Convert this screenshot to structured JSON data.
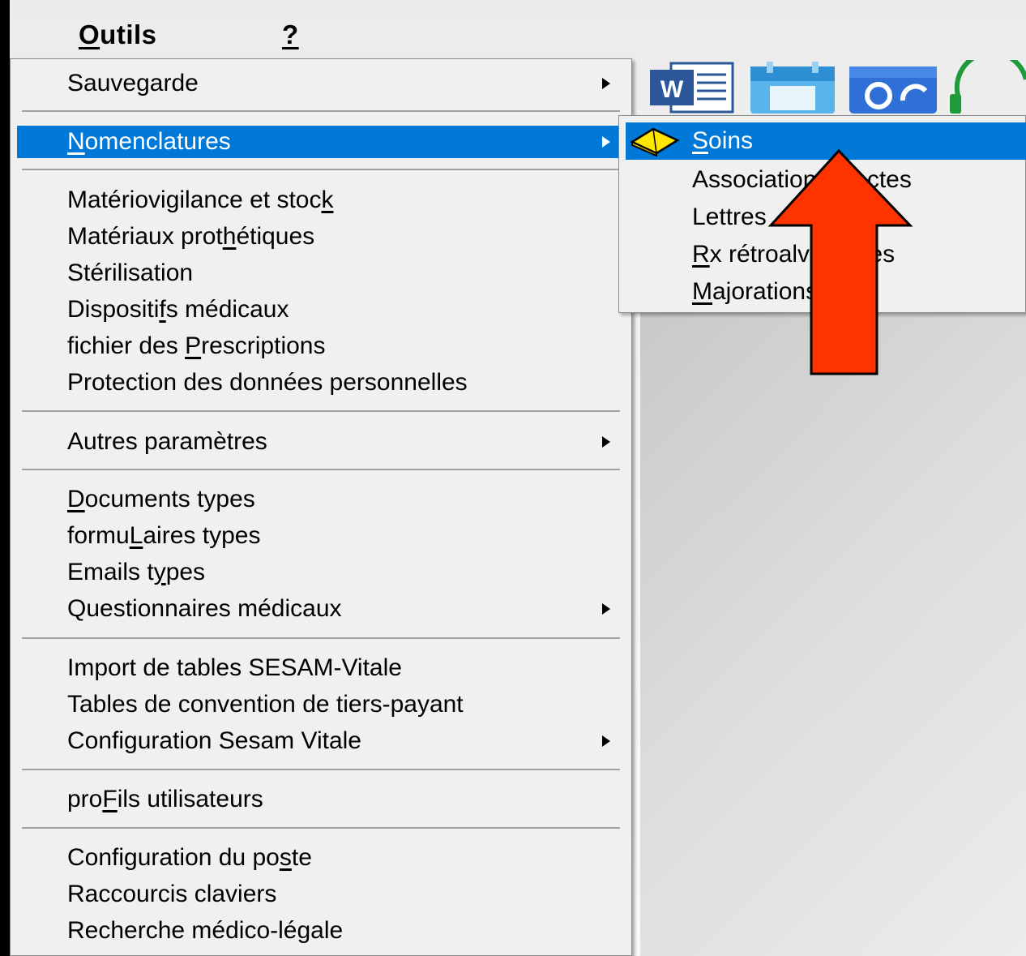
{
  "menubar": {
    "items": [
      {
        "label": "Outils",
        "key": "O",
        "rest": "utils"
      },
      {
        "label": "?"
      }
    ]
  },
  "toolbar": {
    "icons": [
      "word-icon",
      "calendar-icon",
      "google-sync-icon",
      "headset-icon"
    ],
    "word_letter": "W"
  },
  "menu": {
    "items": [
      {
        "pre": "Sauve",
        "key": "g",
        "post": "arde",
        "submenu": true
      },
      {
        "pre": "",
        "key": "N",
        "post": "omenclatures",
        "submenu": true,
        "highlighted": true
      },
      {
        "pre": "Matériovigilance et stoc",
        "key": "k",
        "post": ""
      },
      {
        "pre": "Matériaux prot",
        "key": "h",
        "post": "étiques"
      },
      {
        "pre": "Stérilisation",
        "key": "",
        "post": ""
      },
      {
        "pre": "Dispositi",
        "key": "f",
        "post": "s médicaux"
      },
      {
        "pre": "fichier des ",
        "key": "P",
        "post": "rescriptions"
      },
      {
        "pre": "Protection des données personnelles",
        "key": "",
        "post": ""
      },
      {
        "pre": "Autres paramètres",
        "key": "",
        "post": "",
        "submenu": true
      },
      {
        "pre": "",
        "key": "D",
        "post": "ocuments types"
      },
      {
        "pre": "formu",
        "key": "L",
        "post": "aires types"
      },
      {
        "pre": "Emails t",
        "key": "y",
        "post": "pes"
      },
      {
        "pre": "Questionnaires médicaux",
        "key": "",
        "post": "",
        "submenu": true
      },
      {
        "pre": "Import de tables SESAM-Vitale",
        "key": "",
        "post": ""
      },
      {
        "pre": "Tables de convention de tiers-payant",
        "key": "",
        "post": ""
      },
      {
        "pre": "Configuration Sesam Vitale",
        "key": "",
        "post": "",
        "submenu": true
      },
      {
        "pre": "pro",
        "key": "F",
        "post": "ils utilisateurs"
      },
      {
        "pre": "Configuration du po",
        "key": "s",
        "post": "te"
      },
      {
        "pre": "Raccourcis claviers",
        "key": "",
        "post": ""
      },
      {
        "pre": "Recherche médico-légale",
        "key": "",
        "post": ""
      }
    ]
  },
  "submenu": {
    "items": [
      {
        "pre": "",
        "key": "S",
        "post": "oins",
        "highlighted": true,
        "icon": "book-icon"
      },
      {
        "pre": "Associations d'actes",
        "key": "",
        "post": ""
      },
      {
        "pre": "Lettres",
        "key": "",
        "post": ""
      },
      {
        "pre": "",
        "key": "R",
        "post": "x rétroalvéolaires"
      },
      {
        "pre": "",
        "key": "M",
        "post": "ajorations"
      }
    ]
  },
  "annotation": {
    "icon": "red-arrow-icon",
    "color": "#ff3300"
  },
  "colors": {
    "highlight": "#0078d7",
    "menu_bg": "#f0f0f0"
  }
}
